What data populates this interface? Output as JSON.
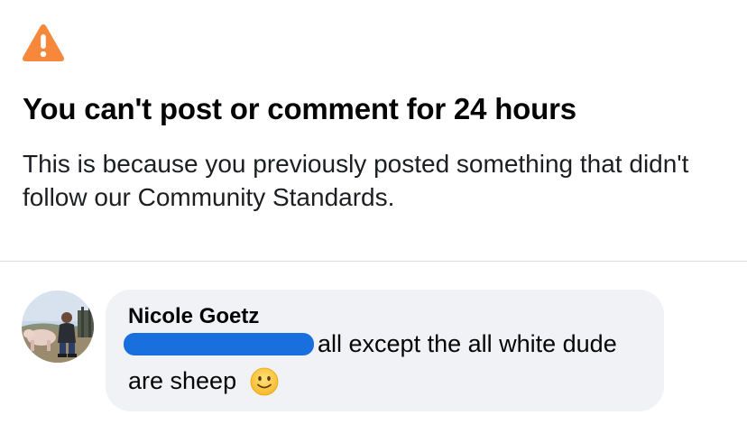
{
  "notice": {
    "icon": "warning-triangle-icon",
    "icon_color": "#F5883A",
    "title": "You can't post or comment for 24 hours",
    "description": "This is because you previously posted something that didn't follow our Community Standards."
  },
  "comment": {
    "author": "Nicole Goetz",
    "avatar": "profile-photo-avatar",
    "redacted_mention_color": "#1A6FDF",
    "text_line1": "all except the all white dude",
    "text_line2": "are sheep",
    "emoji": "slightly-smiling-face-emoji",
    "bubble_color": "#F0F2F5"
  }
}
